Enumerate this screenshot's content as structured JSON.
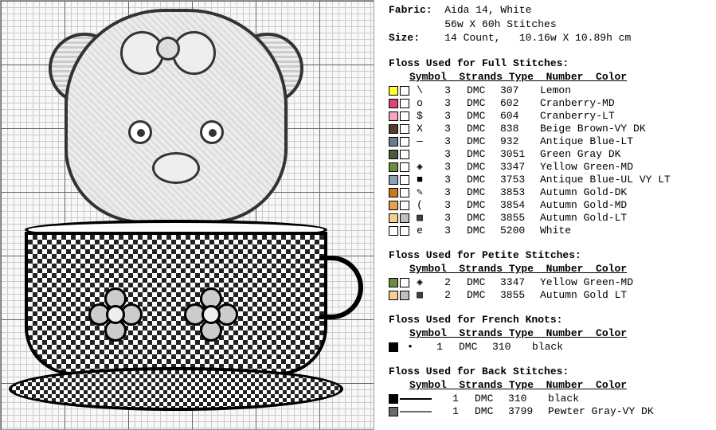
{
  "header": {
    "fabric_label": "Fabric:",
    "fabric_value": "Aida 14, White",
    "stitch_dims": "56w X 60h Stitches",
    "size_label": "Size:",
    "size_value": "14 Count,   10.16w X 10.89h cm"
  },
  "sections": {
    "full": {
      "title": "Floss Used for Full Stitches:",
      "head": "Symbol  Strands Type  Number  Color",
      "rows": [
        {
          "c1": "#ffff33",
          "c2": "#ffffff",
          "sym": "\\",
          "str": "3",
          "type": "DMC",
          "num": "307",
          "color": "Lemon"
        },
        {
          "c1": "#dd4477",
          "c2": "#ffffff",
          "sym": "o",
          "str": "3",
          "type": "DMC",
          "num": "602",
          "color": "Cranberry-MD"
        },
        {
          "c1": "#f7a3c0",
          "c2": "#ffffff",
          "sym": "$",
          "str": "3",
          "type": "DMC",
          "num": "604",
          "color": "Cranberry-LT"
        },
        {
          "c1": "#5a3b28",
          "c2": "#ffffff",
          "sym": "X",
          "str": "3",
          "type": "DMC",
          "num": "838",
          "color": "Beige Brown-VY DK"
        },
        {
          "c1": "#6a7d90",
          "c2": "#ffffff",
          "sym": "—",
          "str": "3",
          "type": "DMC",
          "num": "932",
          "color": "Antique Blue-LT"
        },
        {
          "c1": "#4a5a3a",
          "c2": "#ffffff",
          "sym": "",
          "str": "3",
          "type": "DMC",
          "num": "3051",
          "color": "Green Gray DK"
        },
        {
          "c1": "#6d8b3f",
          "c2": "#ffffff",
          "sym": "◈",
          "str": "3",
          "type": "DMC",
          "num": "3347",
          "color": "Yellow Green-MD"
        },
        {
          "c1": "#8ca0b5",
          "c2": "#ffffff",
          "sym": "■",
          "str": "3",
          "type": "DMC",
          "num": "3753",
          "color": "Antique Blue-UL VY LT"
        },
        {
          "c1": "#c77a1e",
          "c2": "#ffffff",
          "sym": "✎",
          "str": "3",
          "type": "DMC",
          "num": "3853",
          "color": "Autumn Gold-DK"
        },
        {
          "c1": "#e6a24f",
          "c2": "#ffffff",
          "sym": "(",
          "str": "3",
          "type": "DMC",
          "num": "3854",
          "color": "Autumn Gold-MD"
        },
        {
          "c1": "#f5cf90",
          "c2": "#bfbfbf",
          "sym": "▩",
          "str": "3",
          "type": "DMC",
          "num": "3855",
          "color": "Autumn Gold-LT"
        },
        {
          "c1": "#ffffff",
          "c2": "#ffffff",
          "sym": "e",
          "str": "3",
          "type": "DMC",
          "num": "5200",
          "color": "White"
        }
      ]
    },
    "petite": {
      "title": "Floss Used for Petite Stitches:",
      "head": "Symbol  Strands Type  Number  Color",
      "rows": [
        {
          "c1": "#6d8b3f",
          "c2": "#ffffff",
          "sym": "◈",
          "str": "2",
          "type": "DMC",
          "num": "3347",
          "color": "Yellow Green-MD"
        },
        {
          "c1": "#f5cf90",
          "c2": "#bfbfbf",
          "sym": "▩",
          "str": "2",
          "type": "DMC",
          "num": "3855",
          "color": "Autumn Gold LT"
        }
      ]
    },
    "french": {
      "title": "Floss Used for French Knots:",
      "head": "Symbol  Strands Type  Number  Color",
      "rows": [
        {
          "c1": "#000000",
          "sym": "•",
          "str": "1",
          "type": "DMC",
          "num": "310",
          "color": "black"
        }
      ]
    },
    "back": {
      "title": "Floss Used for Back Stitches:",
      "head": "Symbol  Strands Type  Number  Color",
      "rows": [
        {
          "c1": "#000000",
          "str": "1",
          "type": "DMC",
          "num": "310",
          "color": "black"
        },
        {
          "c1": "#6b6b6b",
          "str": "1",
          "type": "DMC",
          "num": "3799",
          "color": "Pewter Gray-VY DK"
        }
      ]
    }
  }
}
